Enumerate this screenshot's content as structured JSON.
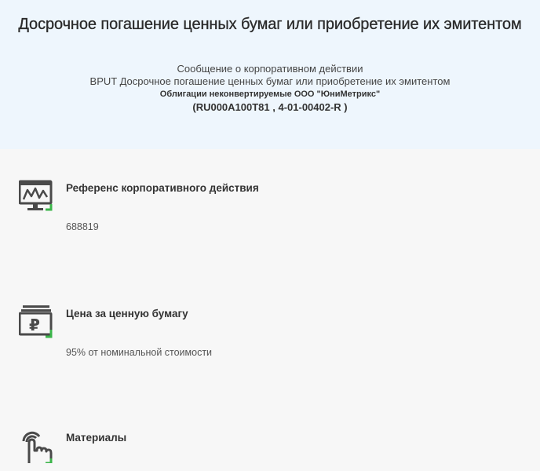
{
  "header": {
    "title": "Досрочное погашение ценных бумаг или приобретение их эмитентом",
    "subtitle": "Сообщение о корпоративном действии",
    "event_line": "BPUT Досрочное погашение ценных бумаг или приобретение их эмитентом",
    "security_name": "Облигации неконвертируемые ООО \"ЮниМетрикс\"",
    "security_codes": "(RU000A100T81 , 4-01-00402-R )"
  },
  "sections": [
    {
      "icon": "monitor-chart-icon",
      "title": "Референс корпоративного действия",
      "value": "688819"
    },
    {
      "icon": "ruble-cards-icon",
      "title": "Цена за ценную бумагу",
      "value": "95% от номинальной стоимости"
    },
    {
      "icon": "hand-tap-icon",
      "title": "Материалы",
      "value": ""
    }
  ],
  "colors": {
    "header_bg": "#eef6fd",
    "page_bg": "#f7f7f7",
    "icon_dark": "#4a4a4a",
    "icon_accent": "#3bb54a"
  }
}
